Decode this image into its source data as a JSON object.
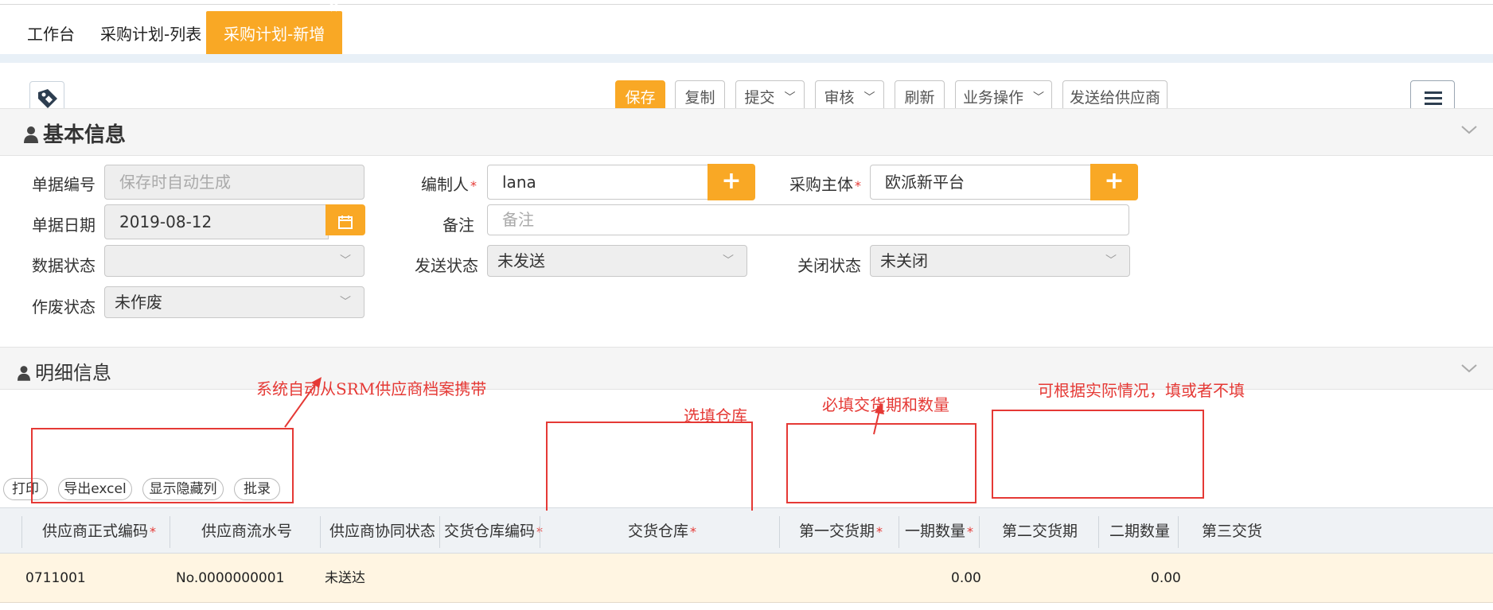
{
  "tabs": [
    {
      "label": "工作台"
    },
    {
      "label": "采购计划-列表"
    },
    {
      "label": "采购计划-新增",
      "active": true
    }
  ],
  "toolbar": {
    "save": "保存",
    "copy": "复制",
    "submit": "提交",
    "audit": "审核",
    "refresh": "刷新",
    "business": "业务操作",
    "send": "发送给供应商"
  },
  "basic": {
    "title": "基本信息",
    "doc_no_label": "单据编号",
    "doc_no_placeholder": "保存时自动生成",
    "author_label": "编制人",
    "author_value": "lana",
    "org_label": "采购主体",
    "org_value": "欧派新平台",
    "date_label": "单据日期",
    "date_value": "2019-08-12",
    "remark_label": "备注",
    "remark_placeholder": "备注",
    "data_status_label": "数据状态",
    "data_status_value": "",
    "send_status_label": "发送状态",
    "send_status_value": "未发送",
    "close_status_label": "关闭状态",
    "close_status_value": "未关闭",
    "void_status_label": "作废状态",
    "void_status_value": "未作废"
  },
  "detail": {
    "title": "明细信息",
    "buttons": {
      "print": "打印",
      "export": "导出excel",
      "show_hidden": "显示隐藏列",
      "batch": "批录"
    },
    "columns": {
      "supplier_code": "供应商正式编码",
      "supplier_serial": "供应商流水号",
      "collab_status": "供应商协同状态",
      "warehouse_code": "交货仓库编码",
      "warehouse": "交货仓库",
      "first_date": "第一交货期",
      "first_qty": "一期数量",
      "second_date": "第二交货期",
      "second_qty": "二期数量",
      "third_date": "第三交货"
    },
    "row": {
      "supplier_code": "0711001",
      "supplier_serial": "No.0000000001",
      "collab_status": "未送达",
      "first_qty": "0.00",
      "second_qty": "0.00"
    }
  },
  "annotations": {
    "srm": "系统自动从SRM供应商档案携带",
    "warehouse": "选填仓库",
    "required": "必填交货期和数量",
    "optional": "可根据实际情况，填或者不填"
  },
  "colors": {
    "accent": "#f9a825",
    "annotation": "#e53935"
  }
}
